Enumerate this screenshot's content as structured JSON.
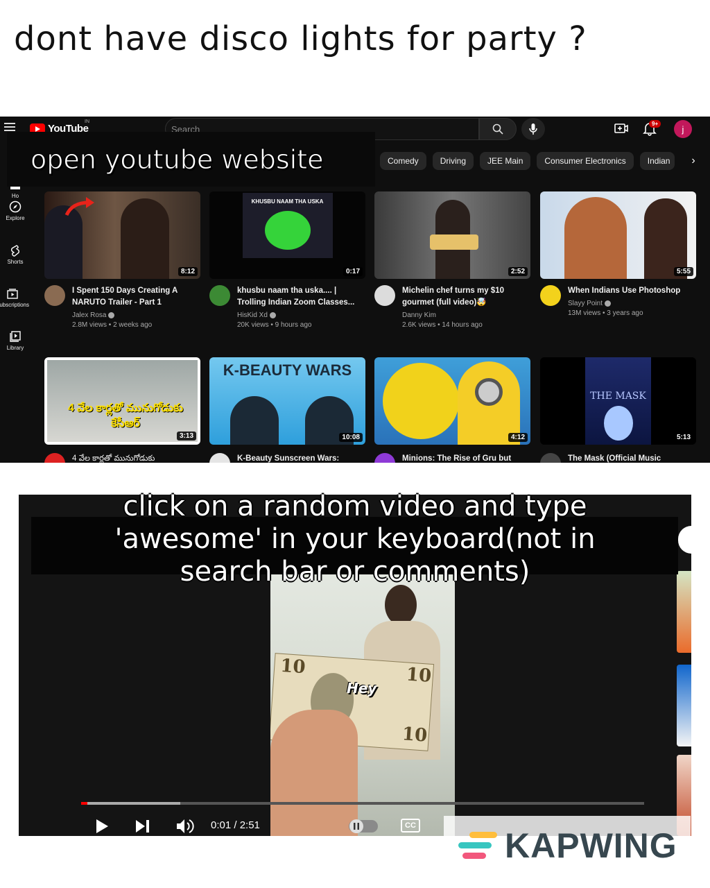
{
  "meme": {
    "title": "dont have disco lights for party ?",
    "step1": "open youtube website",
    "step2": "click on a random video and type 'awesome' in your keyboard(not in search bar or comments)"
  },
  "youtube": {
    "logo_text": "YouTube",
    "region": "IN",
    "search_placeholder": "Search",
    "notification_count": "9+",
    "avatar_letter": "j",
    "sidebar": [
      {
        "label": "Ho",
        "icon": "home-icon"
      },
      {
        "label": "Explore",
        "icon": "compass-icon"
      },
      {
        "label": "Shorts",
        "icon": "shorts-icon"
      },
      {
        "label": "Subscriptions",
        "icon": "subscriptions-icon"
      },
      {
        "label": "Library",
        "icon": "library-icon"
      }
    ],
    "chips": [
      "Comedy",
      "Driving",
      "JEE Main",
      "Consumer Electronics",
      "Indian"
    ],
    "videos": [
      {
        "title": "I Spent 150 Days Creating A NARUTO Trailer - Part 1",
        "channel": "Jalex Rosa",
        "verified": true,
        "stats": "2.8M views • 2 weeks ago",
        "duration": "8:12",
        "thumb_text": ""
      },
      {
        "title": "khusbu naam tha uska.... | Trolling Indian Zoom Classes...",
        "channel": "HisKid Xd",
        "verified": true,
        "stats": "20K views • 9 hours ago",
        "duration": "0:17",
        "thumb_text": "KHUSBU NAAM THA USKA"
      },
      {
        "title": "Michelin chef turns my $10 gourmet (full video)🤯",
        "channel": "Danny Kim",
        "verified": false,
        "stats": "2.6K views • 14 hours ago",
        "duration": "2:52",
        "thumb_text": ""
      },
      {
        "title": "When Indians Use Photoshop",
        "channel": "Slayy Point",
        "verified": true,
        "stats": "13M views • 3 years ago",
        "duration": "5:55",
        "thumb_text": ""
      },
      {
        "title": "4 వేల కార్లతో మునుగోడుకు",
        "channel": "",
        "verified": false,
        "stats": "",
        "duration": "3:13",
        "thumb_text": "4 వేల కార్లతో మునుగోడుకు కేసీఆర్"
      },
      {
        "title": "K-Beauty Sunscreen Wars:",
        "channel": "",
        "verified": false,
        "stats": "",
        "duration": "10:08",
        "thumb_text": "K-BEAUTY WARS"
      },
      {
        "title": "Minions: The Rise of Gru but",
        "channel": "",
        "verified": false,
        "stats": "",
        "duration": "4:12",
        "thumb_text": ""
      },
      {
        "title": "The Mask (Official Music",
        "channel": "",
        "verified": false,
        "stats": "",
        "duration": "5:13",
        "thumb_text": "THE MASK"
      }
    ]
  },
  "player": {
    "caption": "Hey",
    "time": "0:01 / 2:51",
    "cc_label": "CC",
    "progress_played_fraction": 0.011,
    "progress_buffered_fraction": 0.176
  },
  "watermark": {
    "text": "KAPWING"
  },
  "colors": {
    "youtube_red": "#ff0000",
    "dark_bg": "#0f0f0f",
    "chip_bg": "#272727",
    "avatar": "#c2185b",
    "kapwing_text": "#37474f"
  }
}
